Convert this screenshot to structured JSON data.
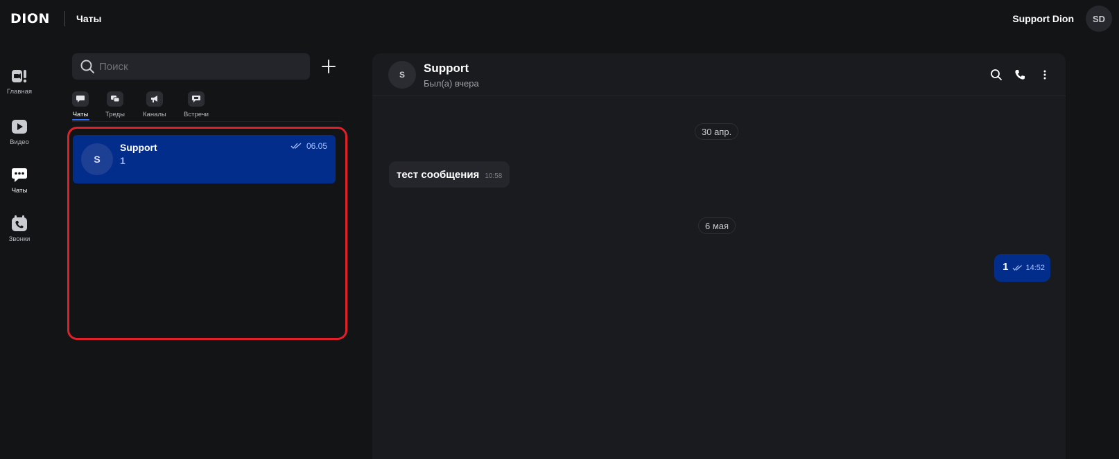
{
  "header": {
    "logo": "DION",
    "section_title": "Чаты",
    "user_name": "Support Dion",
    "user_initials": "SD"
  },
  "nav": {
    "items": [
      {
        "label": "Главная",
        "icon": "home-video-icon"
      },
      {
        "label": "Видео",
        "icon": "play-icon"
      },
      {
        "label": "Чаты",
        "icon": "chat-icon",
        "active": true
      },
      {
        "label": "Звонки",
        "icon": "calendar-phone-icon"
      }
    ]
  },
  "chatlist": {
    "search_placeholder": "Поиск",
    "tabs": [
      {
        "label": "Чаты",
        "active": true
      },
      {
        "label": "Треды"
      },
      {
        "label": "Каналы"
      },
      {
        "label": "Встречи"
      }
    ],
    "chats": [
      {
        "initial": "S",
        "name": "Support",
        "preview": "1",
        "time": "06.05",
        "read": true,
        "selected": true
      }
    ]
  },
  "conversation": {
    "initial": "S",
    "name": "Support",
    "status": "Был(а) вчера",
    "dates": [
      "30 апр.",
      "6 мая"
    ],
    "messages": [
      {
        "direction": "in",
        "text": "тест сообщения",
        "time": "10:58"
      },
      {
        "direction": "out",
        "text": "1",
        "time": "14:52",
        "read": true
      }
    ]
  },
  "colors": {
    "background": "#131416",
    "panel": "#1a1b1e",
    "accent_blue": "#032d8a",
    "highlight_red": "#e0202a",
    "tab_underline": "#2f6bff"
  }
}
